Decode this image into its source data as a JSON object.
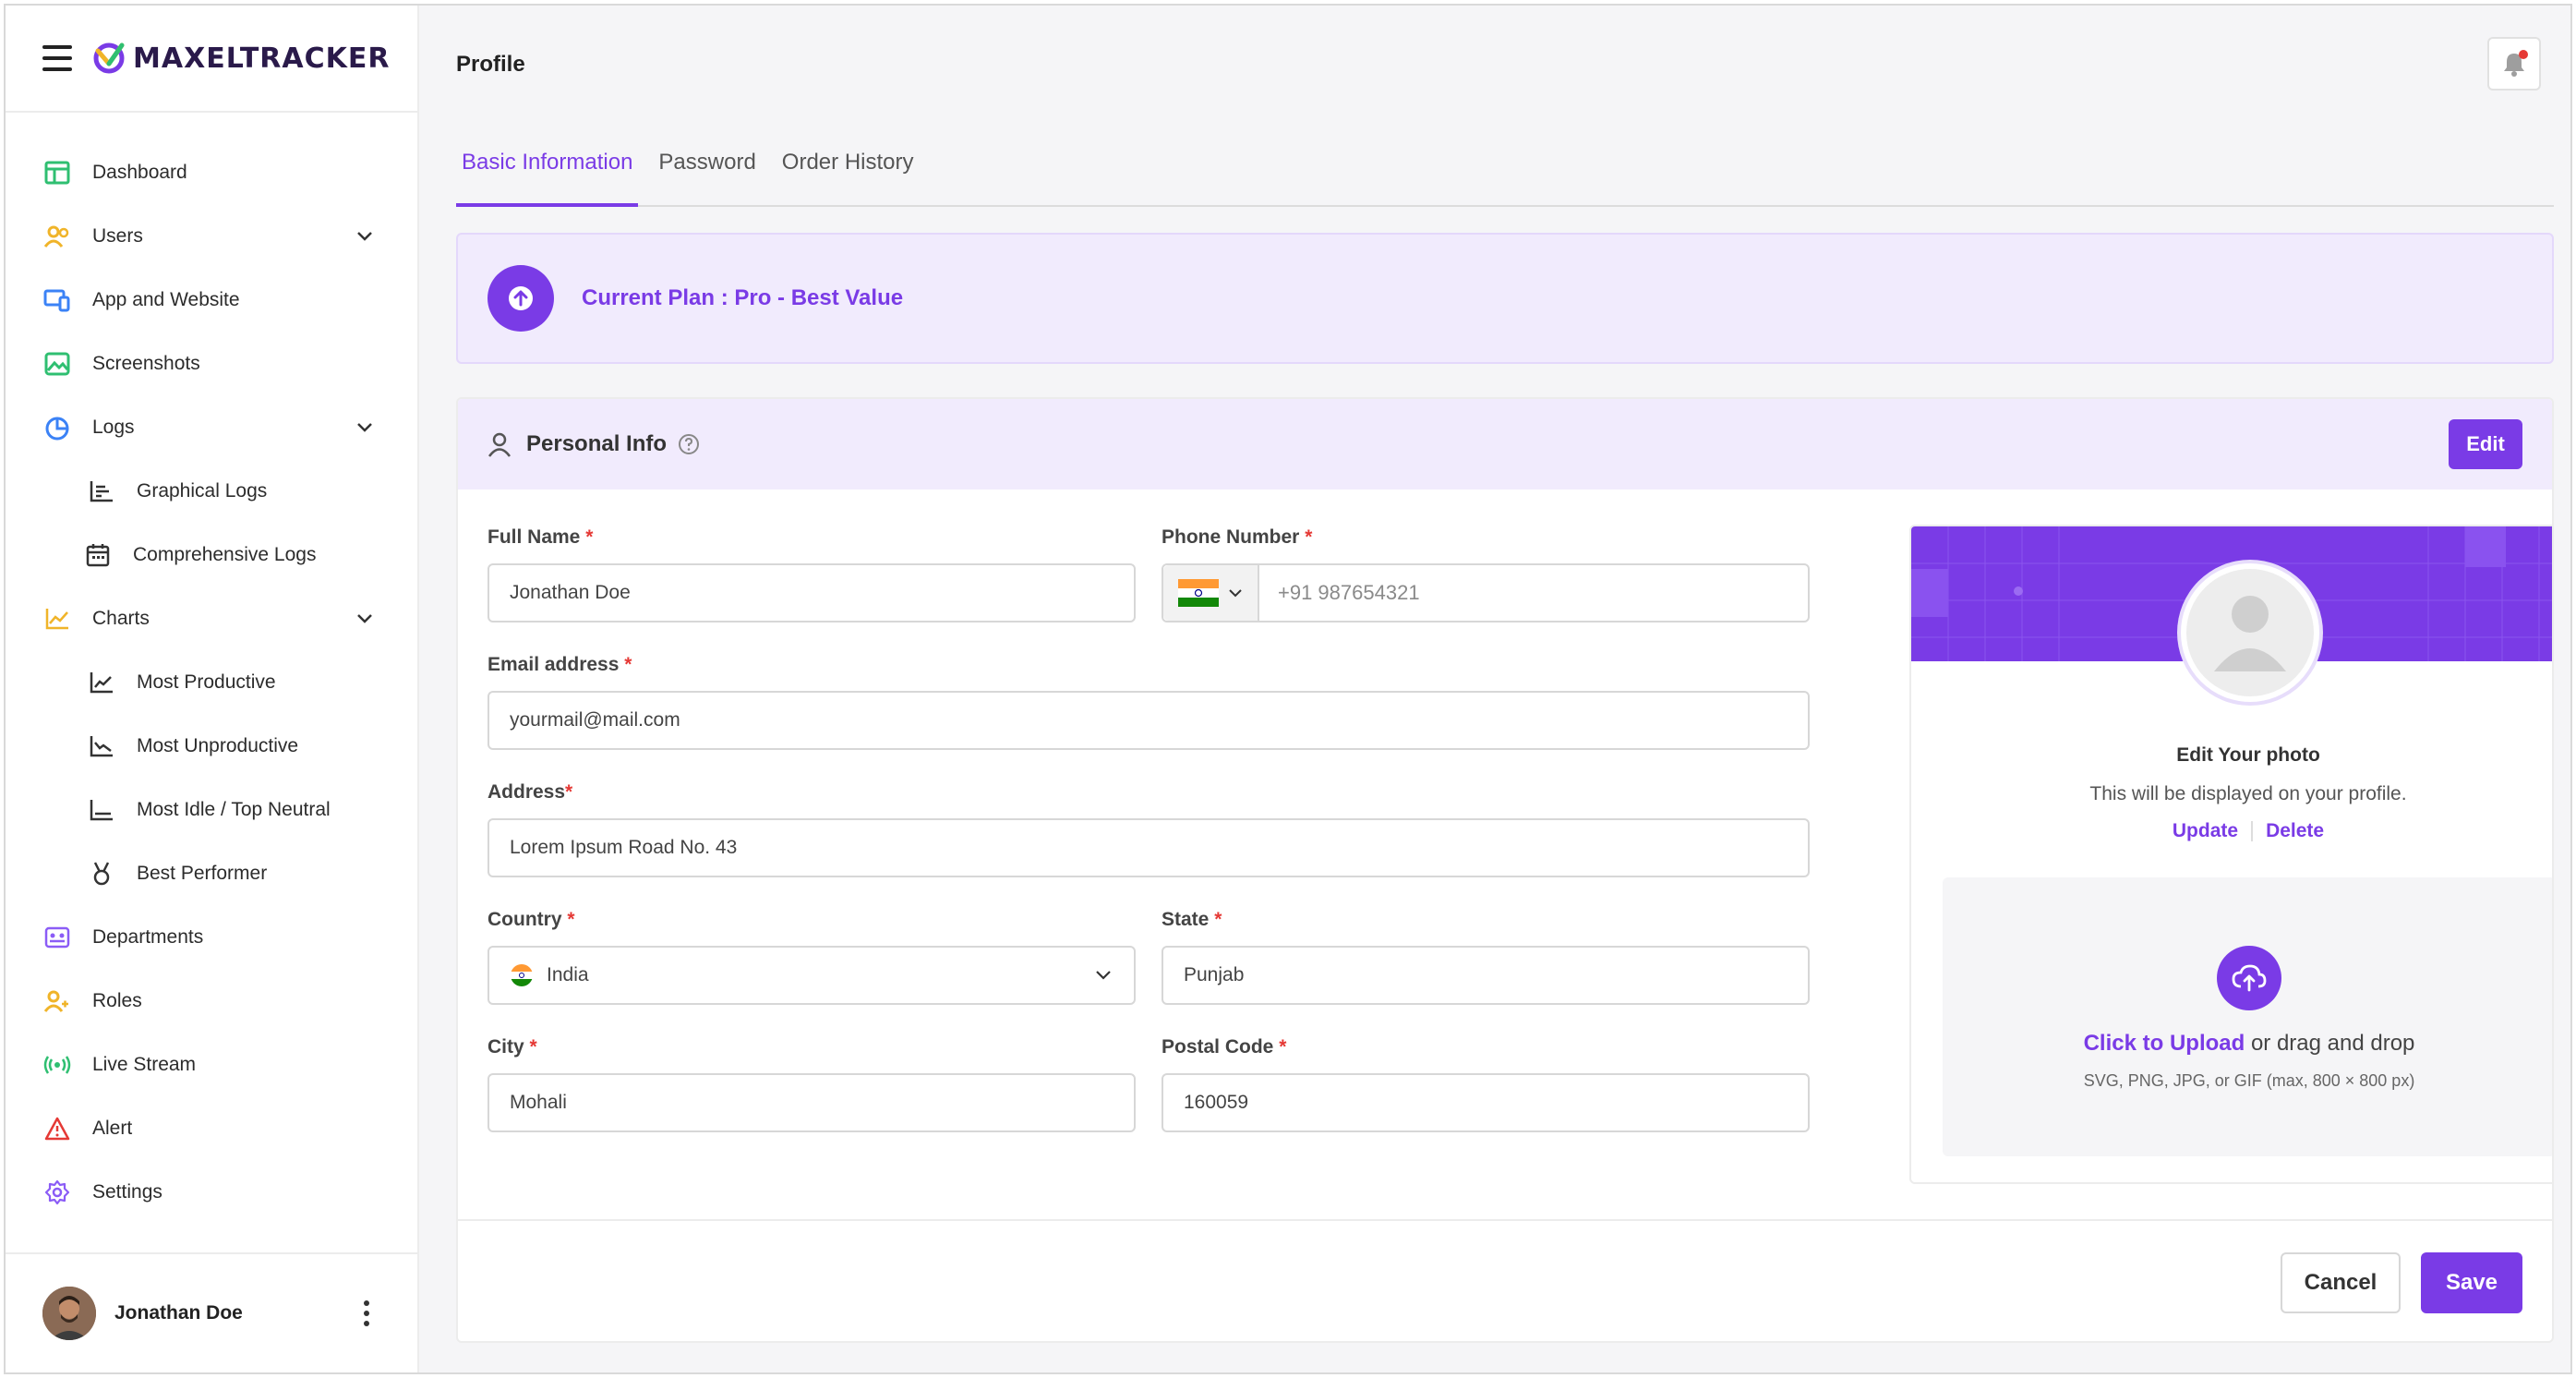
{
  "app": {
    "brand": "MAXELTRACKER"
  },
  "sidebar": {
    "items": [
      {
        "label": "Dashboard",
        "icon": "dashboard-icon"
      },
      {
        "label": "Users",
        "icon": "users-icon"
      },
      {
        "label": "App and Website",
        "icon": "devices-icon"
      },
      {
        "label": "Screenshots",
        "icon": "image-icon"
      },
      {
        "label": "Logs",
        "icon": "pie-chart-icon"
      },
      {
        "label": "Graphical Logs",
        "icon": "bar-chart-icon"
      },
      {
        "label": "Comprehensive Logs",
        "icon": "calendar-icon"
      },
      {
        "label": "Charts",
        "icon": "line-chart-icon"
      },
      {
        "label": "Most Productive",
        "icon": "trend-up-icon"
      },
      {
        "label": "Most Unproductive",
        "icon": "trend-down-icon"
      },
      {
        "label": "Most Idle / Top Neutral",
        "icon": "flat-chart-icon"
      },
      {
        "label": "Best Performer",
        "icon": "medal-icon"
      },
      {
        "label": "Departments",
        "icon": "departments-icon"
      },
      {
        "label": "Roles",
        "icon": "roles-icon"
      },
      {
        "label": "Live Stream",
        "icon": "broadcast-icon"
      },
      {
        "label": "Alert",
        "icon": "warning-icon"
      },
      {
        "label": "Settings",
        "icon": "gear-icon"
      }
    ],
    "user": {
      "name": "Jonathan Doe"
    }
  },
  "header": {
    "title": "Profile"
  },
  "tabs": [
    {
      "label": "Basic Information"
    },
    {
      "label": "Password"
    },
    {
      "label": "Order History"
    }
  ],
  "plan": {
    "text": "Current Plan : Pro - Best Value"
  },
  "personal": {
    "title": "Personal Info",
    "edit_label": "Edit",
    "fields": {
      "full_name": {
        "label": "Full Name",
        "value": "Jonathan Doe"
      },
      "phone": {
        "label": "Phone Number",
        "placeholder": "+91 987654321"
      },
      "email": {
        "label": "Email address",
        "value": "yourmail@mail.com"
      },
      "address": {
        "label": "Address",
        "value": "Lorem Ipsum Road No. 43"
      },
      "country": {
        "label": "Country",
        "value": "India"
      },
      "state": {
        "label": "State",
        "value": "Punjab"
      },
      "city": {
        "label": "City",
        "value": "Mohali"
      },
      "postal": {
        "label": "Postal Code",
        "value": "160059"
      }
    },
    "required_mark": "*"
  },
  "photo": {
    "title": "Edit Your photo",
    "subtitle": "This will be displayed on your profile.",
    "update_label": "Update",
    "delete_label": "Delete",
    "upload_cta": "Click to Upload",
    "upload_rest": " or drag and drop",
    "upload_hint": "SVG, PNG, JPG, or GIF (max, 800 × 800 px)"
  },
  "footer": {
    "cancel_label": "Cancel",
    "save_label": "Save"
  },
  "colors": {
    "accent": "#7a3be6",
    "accent_light": "#f1ebfd",
    "required": "#e53935"
  }
}
